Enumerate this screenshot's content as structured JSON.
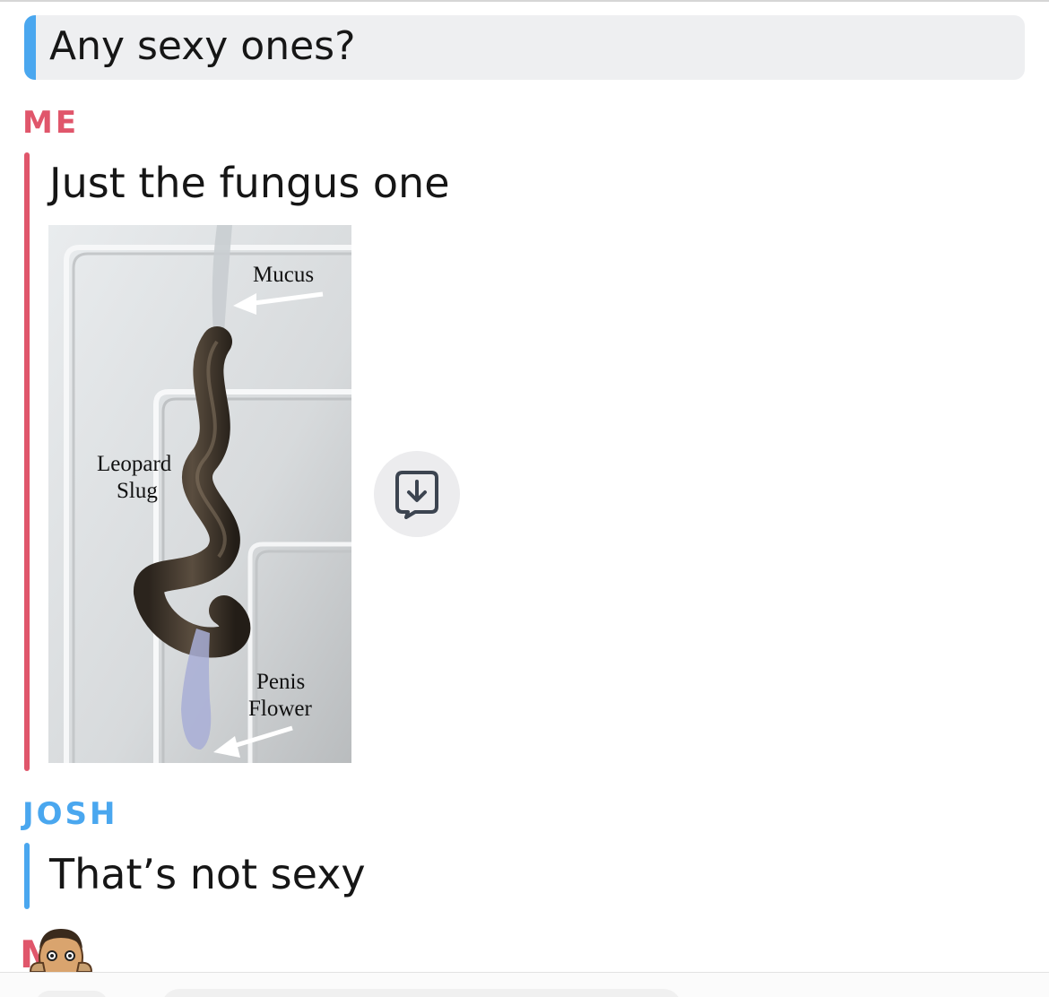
{
  "quoted_message": {
    "text": "Any sexy ones?",
    "accent_color": "#4aa7ef"
  },
  "messages": [
    {
      "sender": "ME",
      "sender_color": "#e0566b",
      "text": "Just the fungus one",
      "image": {
        "labels": {
          "mucus": "Mucus",
          "slug_line1": "Leopard",
          "slug_line2": "Slug",
          "penis_line1": "Penis",
          "penis_line2": "Flower"
        }
      },
      "save_icon": "save-to-chat-icon"
    },
    {
      "sender": "JOSH",
      "sender_color": "#4aa7ef",
      "text": "That’s not sexy"
    }
  ],
  "typing_indicator": {
    "initial": "M",
    "avatar": "bitmoji-avatar-icon"
  }
}
